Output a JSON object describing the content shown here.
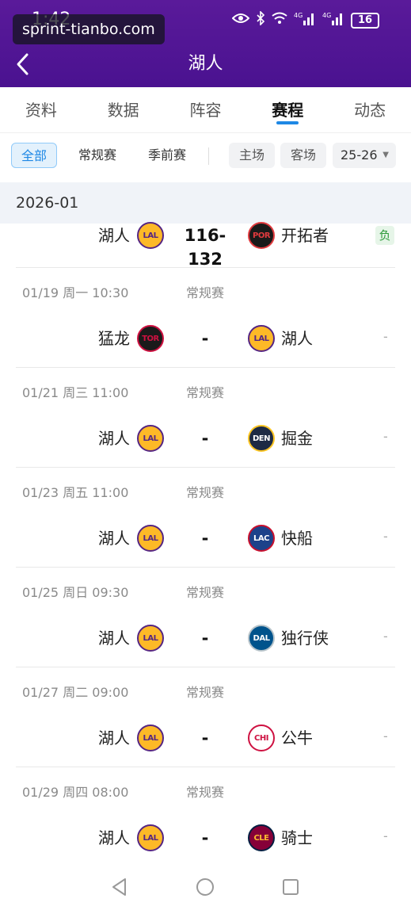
{
  "status_bar": {
    "time": "1:42",
    "battery": "16",
    "signal_labels": [
      "4G",
      "4G"
    ]
  },
  "watermark": "sprint-tianbo.com",
  "header": {
    "title": "湖人"
  },
  "tabs": [
    {
      "label": "资料",
      "active": false
    },
    {
      "label": "数据",
      "active": false
    },
    {
      "label": "阵容",
      "active": false
    },
    {
      "label": "赛程",
      "active": true
    },
    {
      "label": "动态",
      "active": false
    }
  ],
  "filters": {
    "all": "全部",
    "regular": "常规赛",
    "preseason": "季前赛",
    "home": "主场",
    "away": "客场",
    "season": "25-26"
  },
  "month": "2026-01",
  "games": [
    {
      "date": "",
      "type": "",
      "home": "湖人",
      "home_logo": "LAL",
      "away": "开拓者",
      "away_logo": "POR",
      "score": "116-132",
      "result": "负"
    },
    {
      "date": "01/19  周一 10:30",
      "type": "常规赛",
      "home": "猛龙",
      "home_logo": "TOR",
      "away": "湖人",
      "away_logo": "LAL",
      "score": "-",
      "result": "-"
    },
    {
      "date": "01/21  周三 11:00",
      "type": "常规赛",
      "home": "湖人",
      "home_logo": "LAL",
      "away": "掘金",
      "away_logo": "DEN",
      "score": "-",
      "result": "-"
    },
    {
      "date": "01/23  周五 11:00",
      "type": "常规赛",
      "home": "湖人",
      "home_logo": "LAL",
      "away": "快船",
      "away_logo": "LAC",
      "score": "-",
      "result": "-"
    },
    {
      "date": "01/25  周日 09:30",
      "type": "常规赛",
      "home": "湖人",
      "home_logo": "LAL",
      "away": "独行侠",
      "away_logo": "DAL",
      "score": "-",
      "result": "-"
    },
    {
      "date": "01/27  周二 09:00",
      "type": "常规赛",
      "home": "湖人",
      "home_logo": "LAL",
      "away": "公牛",
      "away_logo": "CHI",
      "score": "-",
      "result": "-"
    },
    {
      "date": "01/29  周四 08:00",
      "type": "常规赛",
      "home": "湖人",
      "home_logo": "LAL",
      "away": "骑士",
      "away_logo": "CLE",
      "score": "-",
      "result": "-"
    }
  ],
  "colors": {
    "header_bg": "#4a1290",
    "accent": "#1e88e5",
    "win_loss_green": "#2e9b3a",
    "lakers_gold": "#fdb927",
    "lakers_purple": "#552583"
  }
}
